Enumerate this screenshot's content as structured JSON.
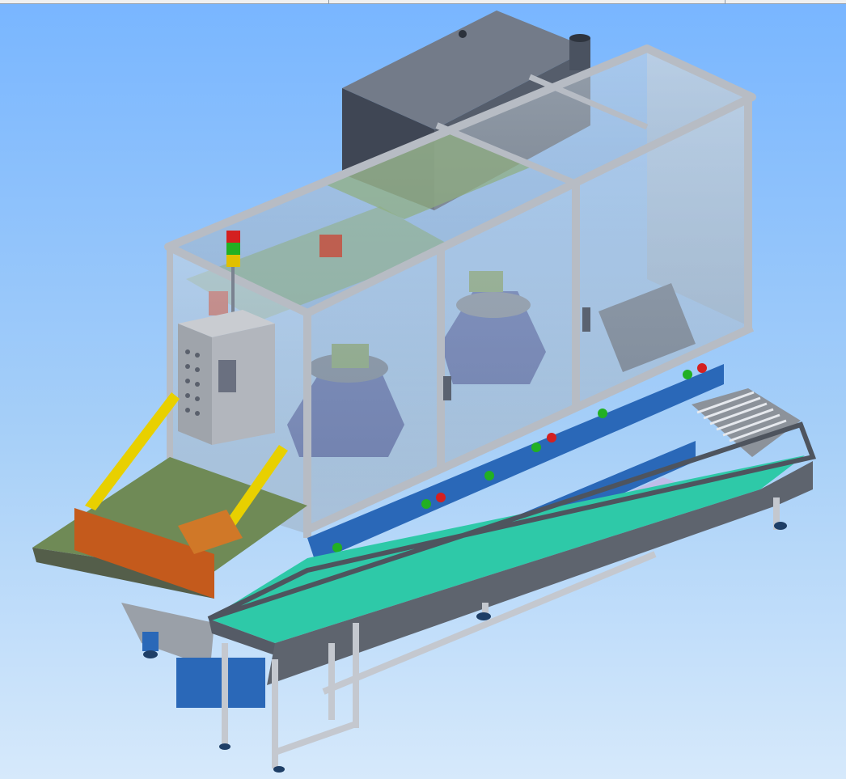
{
  "window": {
    "tabs": [
      "",
      "",
      ""
    ]
  },
  "viewport": {
    "background_top": "#79b6ff",
    "background_bottom": "#d6e9fb",
    "model": {
      "stack_light_colors": [
        "#d42020",
        "#22b022",
        "#e0c000"
      ],
      "conveyor_belt_color": "#2ec9a8",
      "guard_rail_color": "#e8d000",
      "frame_color": "#b7bcc4",
      "base_rail_color": "#2a68b8",
      "enclosure_color": "#5a6270"
    }
  }
}
